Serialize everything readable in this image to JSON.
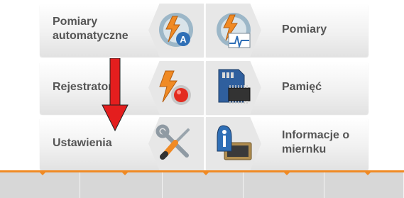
{
  "menu": {
    "auto_measurements_label": "Pomiary automatyczne",
    "measurements_label": "Pomiary",
    "recorder_label": "Rejestrator",
    "memory_label": "Pamięć",
    "settings_label": "Ustawienia",
    "meter_info_label": "Informacje o miernku"
  },
  "icons": {
    "auto_measurements": "lightning-gauge-auto-icon",
    "measurements": "lightning-gauge-waveform-icon",
    "recorder": "lightning-record-icon",
    "memory": "sd-card-chip-icon",
    "settings": "tools-wrench-screwdriver-icon",
    "meter_info": "info-person-device-icon"
  },
  "colors": {
    "accent": "#f08a24",
    "annotation_arrow": "#e41e1e",
    "label_text": "#555555"
  }
}
